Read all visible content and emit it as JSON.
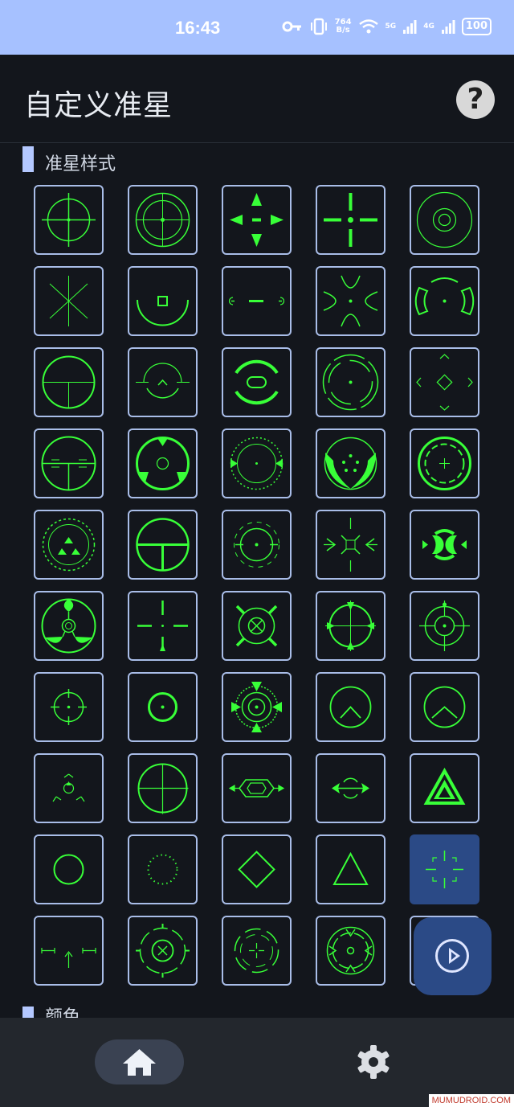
{
  "status_bar": {
    "time": "16:43",
    "net_speed_value": "764",
    "net_speed_unit": "B/s",
    "sig1": "5G",
    "sig2": "4G",
    "battery": "100"
  },
  "header": {
    "title": "自定义准星",
    "help_glyph": "?"
  },
  "sections": {
    "crosshair_style": "准星样式",
    "color": "颜色"
  },
  "crosshairs": {
    "selected_index": 44,
    "count": 50,
    "accent_color": "#38ff38",
    "icons": [
      "circle-crosshair-icon",
      "mildot-scope-icon",
      "four-arrow-crosshair-icon",
      "plus-crosshair-icon",
      "concentric-ring-icon",
      "star-lines-icon",
      "square-bracket-arc-icon",
      "dash-crosshair-icon",
      "converging-arcs-icon",
      "bracket-arcs-icon",
      "circle-tee-icon",
      "half-arc-chevron-icon",
      "ring-oval-icon",
      "double-ring-icon",
      "diamond-chevrons-icon",
      "ranging-scope-icon",
      "triangle-notch-ring-icon",
      "tick-ring-icon",
      "pointed-eyes-icon",
      "dense-ring-icon",
      "dotted-triangle-ring-icon",
      "tee-circle-icon",
      "ring-bracket-icon",
      "spike-reticle-icon",
      "bold-arc-pair-icon",
      "tri-lobe-ring-icon",
      "open-cross-icon",
      "x-target-icon",
      "arrow-ring-icon",
      "tick-ring-cross-icon",
      "small-ring-cross-icon",
      "ring-dot-icon",
      "star-target-icon",
      "chevron-ring-icon",
      "caret-ring-icon",
      "tri-chevron-icon",
      "crossed-circle-icon",
      "hexagon-bar-icon",
      "arrow-pair-icon",
      "bold-triangle-icon",
      "plain-circle-icon",
      "dotted-circle-icon",
      "diamond-icon",
      "triangle-icon",
      "bracket-cross-icon",
      "range-bars-icon",
      "x-ring-icon",
      "gapped-ring-cross-icon",
      "compass-ring-icon",
      "partial-icon"
    ]
  },
  "fab": {
    "icon": "play-circle-icon"
  },
  "bottom_nav": {
    "home_icon": "home-icon",
    "settings_icon": "gear-icon"
  },
  "watermark": "MUMUDROID.COM"
}
